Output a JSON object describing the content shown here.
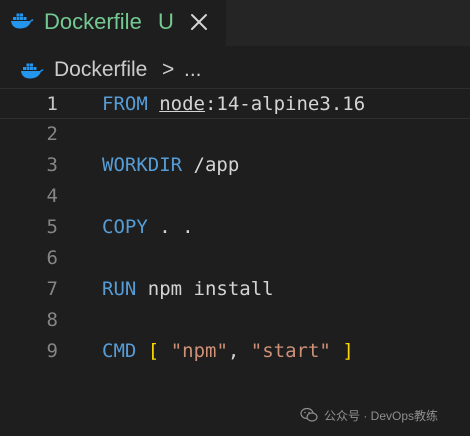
{
  "tab": {
    "filename": "Dockerfile",
    "status_badge": "U",
    "close_icon": "close-icon",
    "file_icon": "docker-whale-icon"
  },
  "breadcrumb": {
    "file": "Dockerfile",
    "separator": ">",
    "more": "..."
  },
  "editor": {
    "current_line": 1,
    "lines": [
      {
        "number": "1",
        "segments": [
          {
            "text": "FROM",
            "type": "keyword"
          },
          {
            "text": " ",
            "type": "plain"
          },
          {
            "text": "node",
            "type": "image"
          },
          {
            "text": ":14-alpine3.16",
            "type": "plain"
          }
        ]
      },
      {
        "number": "2",
        "segments": []
      },
      {
        "number": "3",
        "segments": [
          {
            "text": "WORKDIR",
            "type": "keyword"
          },
          {
            "text": " /app",
            "type": "plain"
          }
        ]
      },
      {
        "number": "4",
        "segments": []
      },
      {
        "number": "5",
        "segments": [
          {
            "text": "COPY",
            "type": "keyword"
          },
          {
            "text": " . .",
            "type": "plain"
          }
        ]
      },
      {
        "number": "6",
        "segments": []
      },
      {
        "number": "7",
        "segments": [
          {
            "text": "RUN",
            "type": "keyword"
          },
          {
            "text": " npm install",
            "type": "plain"
          }
        ]
      },
      {
        "number": "8",
        "segments": []
      },
      {
        "number": "9",
        "segments": [
          {
            "text": "CMD",
            "type": "keyword"
          },
          {
            "text": " ",
            "type": "plain"
          },
          {
            "text": "[",
            "type": "bracket"
          },
          {
            "text": " ",
            "type": "plain"
          },
          {
            "text": "\"npm\"",
            "type": "string"
          },
          {
            "text": ", ",
            "type": "plain"
          },
          {
            "text": "\"start\"",
            "type": "string"
          },
          {
            "text": " ",
            "type": "plain"
          },
          {
            "text": "]",
            "type": "bracket"
          }
        ]
      }
    ]
  },
  "watermark": {
    "text": "公众号 · DevOps教练",
    "icon": "wechat-icon"
  },
  "colors": {
    "background": "#1e1e1e",
    "tab_bar": "#252526",
    "untracked_green": "#73c991",
    "keyword_blue": "#569cd6",
    "string_orange": "#ce9178",
    "bracket_gold": "#ffd700",
    "text": "#d4d4d4",
    "line_number": "#858585",
    "docker_blue": "#2496ed"
  }
}
